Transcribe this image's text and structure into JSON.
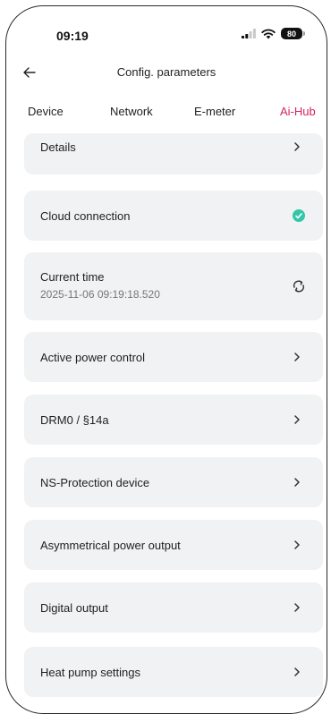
{
  "status": {
    "time": "09:19",
    "battery": "80"
  },
  "header": {
    "title": "Config. parameters",
    "back_icon": "arrow-left-icon"
  },
  "tabs": [
    {
      "label": "Device",
      "active": false
    },
    {
      "label": "Network",
      "active": false
    },
    {
      "label": "E-meter",
      "active": false
    },
    {
      "label": "Ai-Hub",
      "active": true
    }
  ],
  "accent_color": "#d3245b",
  "items": [
    {
      "label": "Details",
      "icon": "chevron-right-icon"
    },
    {
      "label": "Cloud connection",
      "icon": "check-circle-icon"
    },
    {
      "label": "Current time",
      "sub": "2025-11-06 09:19:18.520",
      "icon": "refresh-icon"
    },
    {
      "label": "Active power control",
      "icon": "chevron-right-icon"
    },
    {
      "label": "DRM0 / §14a",
      "icon": "chevron-right-icon"
    },
    {
      "label": "NS-Protection device",
      "icon": "chevron-right-icon"
    },
    {
      "label": "Asymmetrical power output",
      "icon": "chevron-right-icon"
    },
    {
      "label": "Digital output",
      "icon": "chevron-right-icon"
    },
    {
      "label": "Heat pump settings",
      "icon": "chevron-right-icon"
    }
  ]
}
